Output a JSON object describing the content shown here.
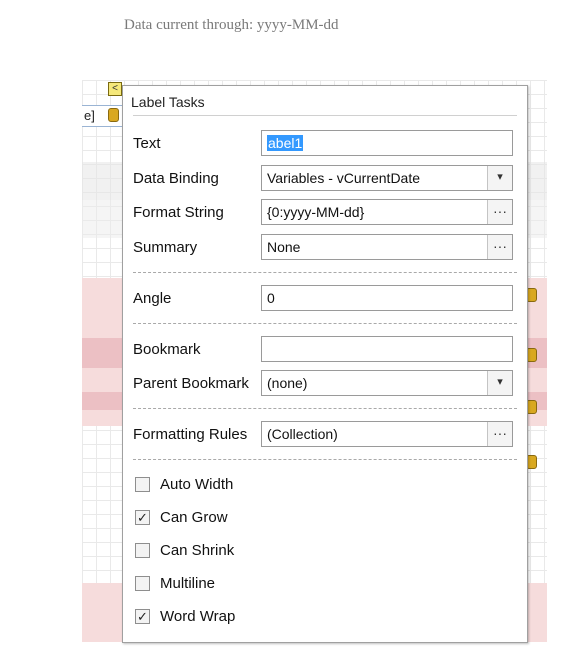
{
  "caption": "Data current through: yyyy-MM-dd",
  "background": {
    "field_fragment": "e] "
  },
  "popup": {
    "title": "Label Tasks",
    "rows": {
      "text": {
        "label": "Text",
        "value": "abel1"
      },
      "data_binding": {
        "label": "Data Binding",
        "value": "Variables - vCurrentDate",
        "button": "▾"
      },
      "format_string": {
        "label": "Format String",
        "value": "{0:yyyy-MM-dd}",
        "button": "···"
      },
      "summary": {
        "label": "Summary",
        "value": "None",
        "button": "···"
      },
      "angle": {
        "label": "Angle",
        "value": "0"
      },
      "bookmark": {
        "label": "Bookmark",
        "value": ""
      },
      "parent_bookmark": {
        "label": "Parent Bookmark",
        "value": "(none)",
        "button": "▾"
      },
      "formatting_rules": {
        "label": "Formatting Rules",
        "value": "(Collection)",
        "button": "···"
      }
    },
    "checkboxes": [
      {
        "label": "Auto Width",
        "checked": false,
        "mark": ""
      },
      {
        "label": "Can Grow",
        "checked": true,
        "mark": "✓"
      },
      {
        "label": "Can Shrink",
        "checked": false,
        "mark": ""
      },
      {
        "label": "Multiline",
        "checked": false,
        "mark": ""
      },
      {
        "label": "Word Wrap",
        "checked": true,
        "mark": "✓"
      }
    ],
    "smart_tag_glyph": "<"
  },
  "colors": {
    "selection": "#3399ff",
    "band_pink": "#f6dcdc",
    "band_pink_dark": "#ecc0c4"
  }
}
